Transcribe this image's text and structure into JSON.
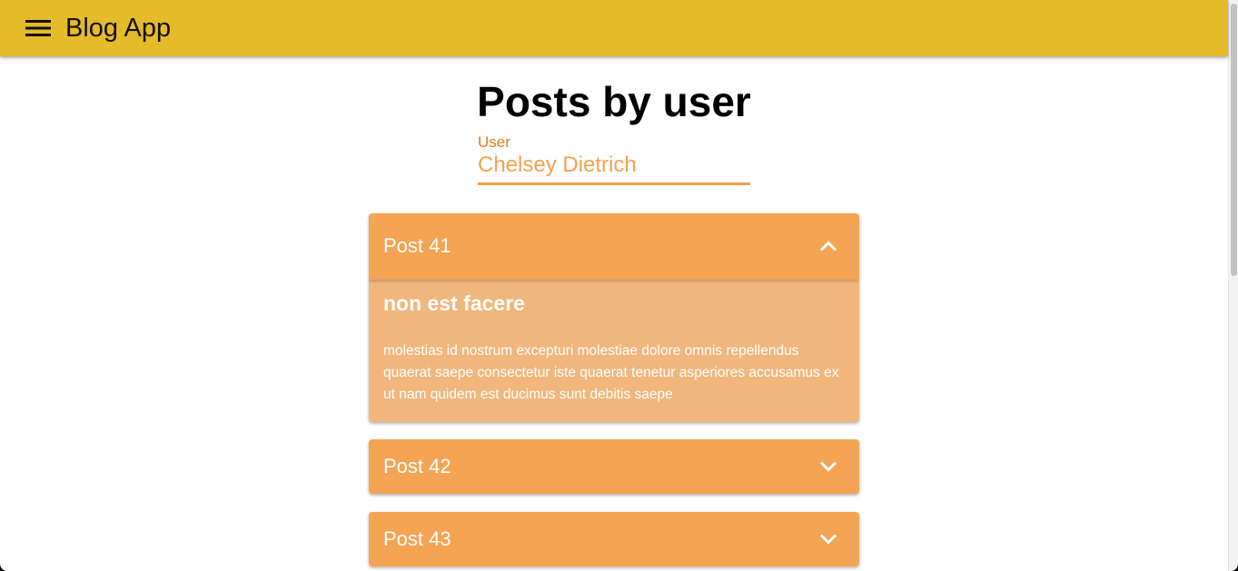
{
  "app": {
    "title": "Blog App",
    "bar_color": "#e6bb2a"
  },
  "page": {
    "title": "Posts by user"
  },
  "user_select": {
    "label": "User",
    "value": "Chelsey Dietrich"
  },
  "posts": [
    {
      "label": "Post 41",
      "expanded": true,
      "title": "non est facere",
      "body": "molestias id nostrum excepturi molestiae dolore omnis repellendus quaerat saepe consectetur iste quaerat tenetur asperiores accusamus ex ut nam quidem est ducimus sunt debitis saepe"
    },
    {
      "label": "Post 42",
      "expanded": false
    },
    {
      "label": "Post 43",
      "expanded": false
    }
  ],
  "icons": {
    "menu": "menu-icon",
    "expand_less": "chevron-up-icon",
    "expand_more": "chevron-down-icon"
  },
  "colors": {
    "accent": "#f5a453",
    "accent_light": "#f1b67c",
    "label_orange": "#e07b1f"
  }
}
